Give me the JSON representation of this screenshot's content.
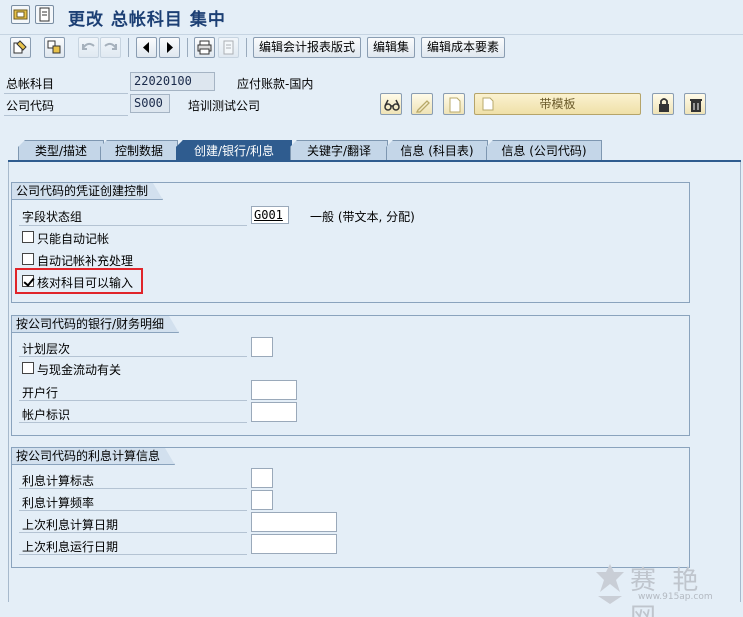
{
  "window": {
    "title": "更改 总帐科目 集中"
  },
  "toolbar": {
    "buttons": [
      {
        "name": "display-change-icon"
      },
      {
        "name": "other-object-icon"
      },
      {
        "name": "previous-entry-icon"
      },
      {
        "name": "next-entry-icon"
      },
      {
        "name": "arrow-left-icon"
      },
      {
        "name": "arrow-right-icon"
      },
      {
        "name": "print-icon"
      },
      {
        "name": "document-icon"
      }
    ],
    "text_buttons": [
      "编辑会计报表版式",
      "编辑集",
      "编辑成本要素"
    ]
  },
  "header": {
    "gl_account_label": "总帐科目",
    "gl_account_value": "22020100",
    "gl_account_desc": "应付账款-国内",
    "company_code_label": "公司代码",
    "company_code_value": "S000",
    "company_code_desc": "培训测试公司",
    "template_button": "带模板"
  },
  "tabs": [
    {
      "label": "类型/描述",
      "active": false
    },
    {
      "label": "控制数据",
      "active": false
    },
    {
      "label": "创建/银行/利息",
      "active": true
    },
    {
      "label": "关键字/翻译",
      "active": false
    },
    {
      "label": "信息 (科目表)",
      "active": false
    },
    {
      "label": "信息 (公司代码)",
      "active": false
    }
  ],
  "group1": {
    "title": "公司代码的凭证创建控制",
    "field_status_label": "字段状态组",
    "field_status_value": "G001",
    "field_status_desc": "一般 (带文本, 分配)",
    "checkbox_post_auto_only": {
      "label": "只能自动记帐",
      "checked": false
    },
    "checkbox_supplement_auto": {
      "label": "自动记帐补充处理",
      "checked": false
    },
    "checkbox_recon_input": {
      "label": "核对科目可以输入",
      "checked": true
    }
  },
  "group2": {
    "title": "按公司代码的银行/财务明细",
    "planning_level_label": "计划层次",
    "checkbox_cash_flow": {
      "label": "与现金流动有关",
      "checked": false
    },
    "house_bank_label": "开户行",
    "account_id_label": "帐户标识"
  },
  "group3": {
    "title": "按公司代码的利息计算信息",
    "interest_indicator_label": "利息计算标志",
    "interest_frequency_label": "利息计算频率",
    "last_calc_date_label": "上次利息计算日期",
    "last_run_date_label": "上次利息运行日期"
  },
  "watermark": {
    "text": "赛 艳 网",
    "url": "www.915ap.com"
  },
  "colors": {
    "title": "#1c3f74",
    "active_tab": "#2f5c8f",
    "highlight": "#e0242a",
    "background": "#e4eef7"
  }
}
